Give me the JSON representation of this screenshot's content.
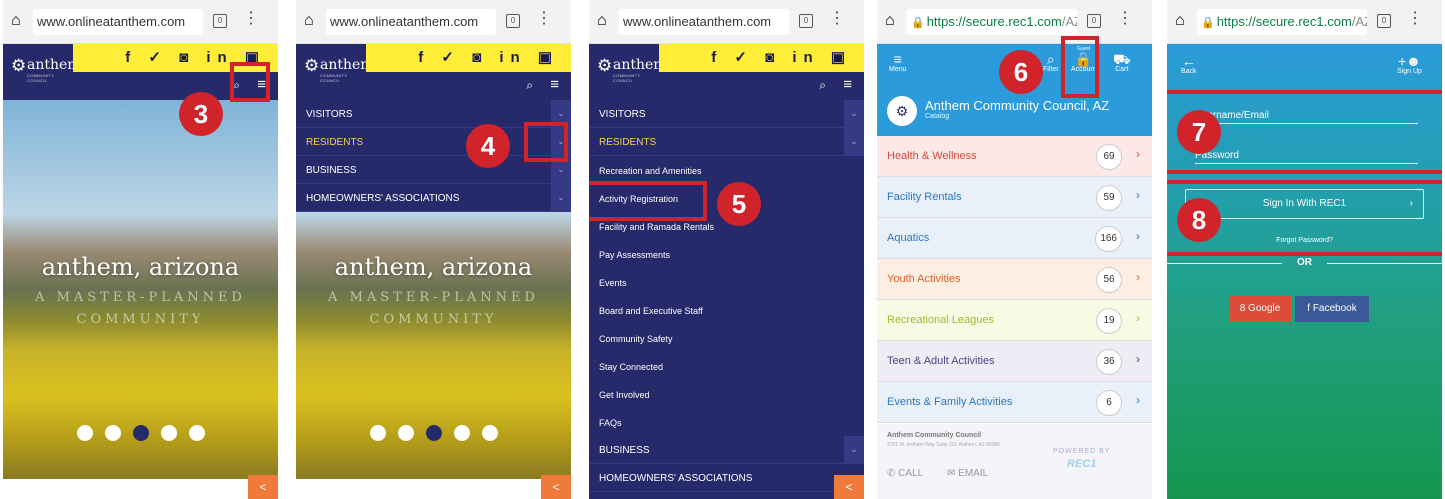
{
  "colors": {
    "anthem_navy": "#262a6b",
    "anthem_yellow": "#ffee37",
    "rec1_blue": "#2b9bdb",
    "highlight_red": "#d1232a",
    "share_orange": "#f07a3a"
  },
  "urls": {
    "anthem": "www.onlineatanthem.com",
    "rec1_host": "https://secure.rec1.com",
    "rec1_path": "/AZ/"
  },
  "browser": {
    "tabs_count": "0",
    "menu_icon": "kebab-icon",
    "home_icon": "home-icon"
  },
  "anthem": {
    "logo": "anthem",
    "logo_sub": "COMMUNITY COUNCIL",
    "social": "f ✓ ◙ in ▣",
    "hero_title": "anthem, arizona",
    "hero_tagline": "A MASTER-PLANNED COMMUNITY"
  },
  "menu_top": [
    "VISITORS",
    "RESIDENTS",
    "BUSINESS",
    "HOMEOWNERS' ASSOCIATIONS"
  ],
  "residents_sub": [
    "Recreation and Amenities",
    "Activity Registration",
    "Facility and Ramada Rentals",
    "Pay Assessments",
    "Events",
    "Board and Executive Staff",
    "Community Safety",
    "Stay Connected",
    "Get Involved",
    "FAQs"
  ],
  "menu_bottom": [
    "BUSINESS",
    "HOMEOWNERS' ASSOCIATIONS"
  ],
  "rec1": {
    "menu_label": "Menu",
    "filter_label": "Filter",
    "account_label": "Account",
    "guest_label": "Guest",
    "cart_label": "Cart",
    "org_name": "Anthem Community Council, AZ",
    "catalog_label": "Catalog",
    "categories": [
      {
        "name": "Health & Wellness",
        "count": "69",
        "bg": "#fde8e8",
        "color": "#d14b3a"
      },
      {
        "name": "Facility Rentals",
        "count": "59",
        "bg": "#eaf0fa",
        "color": "#2b78c0"
      },
      {
        "name": "Aquatics",
        "count": "166",
        "bg": "#eaf0fa",
        "color": "#2b78c0"
      },
      {
        "name": "Youth Activities",
        "count": "56",
        "bg": "#fdeee3",
        "color": "#e0602a"
      },
      {
        "name": "Recreational Leagues",
        "count": "19",
        "bg": "#f7fbe4",
        "color": "#9cbd2f"
      },
      {
        "name": "Teen & Adult Activities",
        "count": "36",
        "bg": "#efecf6",
        "color": "#4a4585"
      },
      {
        "name": "Events & Family Activities",
        "count": "6",
        "bg": "#eaf0fa",
        "color": "#2b78c0"
      }
    ],
    "footer_org": "Anthem Community Council",
    "footer_addr": "3701 W. Anthem Way Suite 201 Anthem, AZ 85086",
    "call": "CALL",
    "email": "EMAIL",
    "powered_by": "POWERED BY",
    "powered_brand": "REC1"
  },
  "login": {
    "back": "Back",
    "signup": "Sign Up",
    "username_placeholder": "Username/Email",
    "password_placeholder": "Password",
    "signin": "Sign In With REC1",
    "forgot": "Forgot Password?",
    "or": "OR",
    "google": "Google",
    "facebook": "Facebook"
  },
  "steps": [
    "3",
    "4",
    "5",
    "6",
    "7",
    "8"
  ]
}
